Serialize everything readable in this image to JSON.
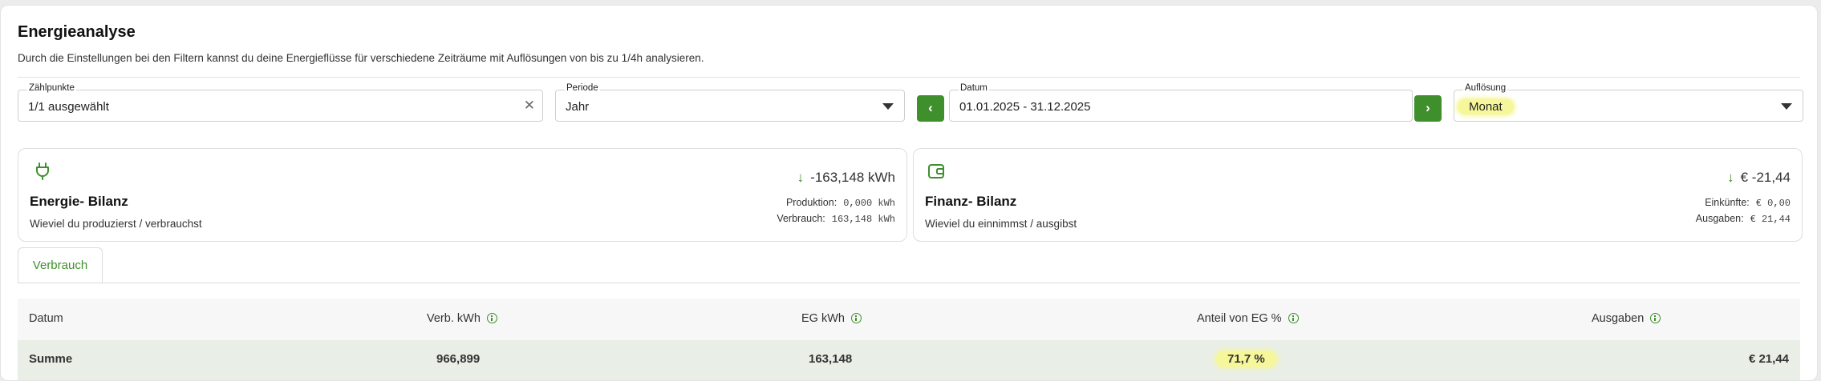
{
  "page": {
    "title": "Energieanalyse",
    "subtitle": "Durch die Einstellungen bei den Filtern kannst du deine Energieflüsse für verschiedene Zeiträume mit Auflösungen von bis zu 1/4h analysieren."
  },
  "filters": {
    "zaehlpunkte": {
      "label": "Zählpunkte",
      "value": "1/1 ausgewählt",
      "clear_icon": "close-icon"
    },
    "periode": {
      "label": "Periode",
      "value": "Jahr"
    },
    "prev_button": "‹",
    "datum": {
      "label": "Datum",
      "value": "01.01.2025 - 31.12.2025"
    },
    "next_button": "›",
    "aufloesung": {
      "label": "Auflösung",
      "value": "Monat"
    }
  },
  "cards": {
    "energie": {
      "icon": "plug-icon",
      "title": "Energie- Bilanz",
      "subtitle": "Wieviel du produzierst / verbrauchst",
      "total": "-163,148 kWh",
      "rows": [
        {
          "label": "Produktion:",
          "value": "0,000 kWh"
        },
        {
          "label": "Verbrauch:",
          "value": "163,148 kWh"
        }
      ]
    },
    "finanz": {
      "icon": "wallet-icon",
      "title": "Finanz- Bilanz",
      "subtitle": "Wieviel du einnimmst / ausgibst",
      "total": "€ -21,44",
      "rows": [
        {
          "label": "Einkünfte:",
          "value": "€ 0,00"
        },
        {
          "label": "Ausgaben:",
          "value": "€ 21,44"
        }
      ]
    }
  },
  "tabs": [
    {
      "label": "Verbrauch",
      "active": true
    }
  ],
  "table": {
    "columns": [
      "Datum",
      "Verb. kWh",
      "EG kWh",
      "Anteil von EG %",
      "Ausgaben"
    ],
    "rows": [
      {
        "cells": [
          "Summe",
          "966,899",
          "163,148",
          "71,7 %",
          "€ 21,44"
        ]
      }
    ]
  },
  "colors": {
    "accent": "#3f8f2c",
    "highlight": "#f6f79a",
    "summary_row": "#e9efe6"
  }
}
